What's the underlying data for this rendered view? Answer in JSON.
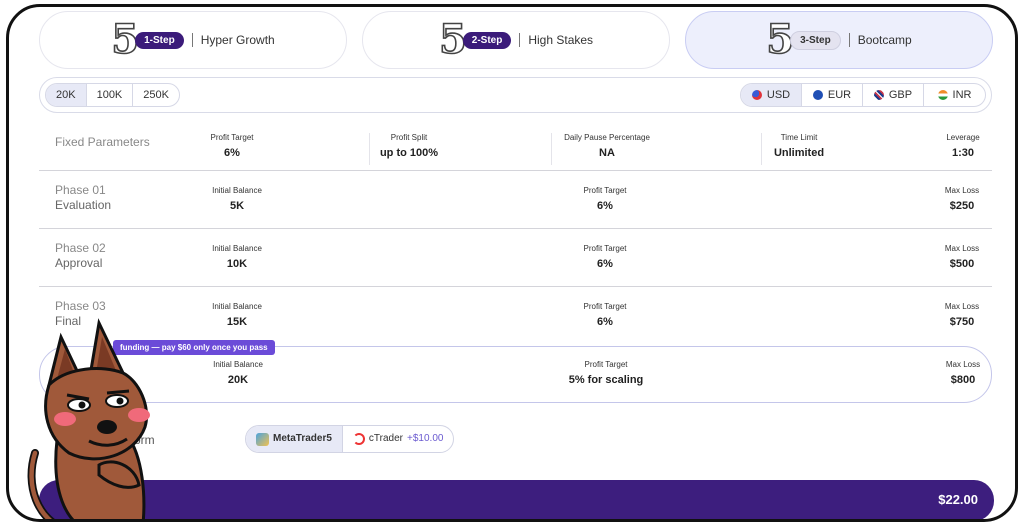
{
  "steps": [
    {
      "number": "5",
      "badge": "1-Step",
      "label": "Hyper Growth",
      "active": false
    },
    {
      "number": "5",
      "badge": "2-Step",
      "label": "High Stakes",
      "active": false
    },
    {
      "number": "5",
      "badge": "3-Step",
      "label": "Bootcamp",
      "active": true
    }
  ],
  "sizes": [
    "20K",
    "100K",
    "250K"
  ],
  "selected_size": "20K",
  "currencies": [
    {
      "code": "USD",
      "color": "#3b5bd6"
    },
    {
      "code": "EUR",
      "color": "#1f4fb5"
    },
    {
      "code": "GBP",
      "color": "#c8364a"
    },
    {
      "code": "INR",
      "color": "#f08c2a"
    }
  ],
  "selected_currency": "USD",
  "fixed": {
    "title": "Fixed Parameters",
    "cols": [
      {
        "label": "Profit Target",
        "value": "6%"
      },
      {
        "label": "Profit Split",
        "value": "up to 100%"
      },
      {
        "label": "Daily Pause Percentage",
        "value": "NA"
      },
      {
        "label": "Time Limit",
        "value": "Unlimited"
      },
      {
        "label": "Leverage",
        "value": "1:30"
      }
    ]
  },
  "phases": [
    {
      "title": "Phase 01",
      "subtitle": "Evaluation",
      "balance_label": "Initial Balance",
      "balance": "5K",
      "target_label": "Profit Target",
      "target": "6%",
      "loss_label": "Max Loss",
      "loss": "$250"
    },
    {
      "title": "Phase 02",
      "subtitle": "Approval",
      "balance_label": "Initial Balance",
      "balance": "10K",
      "target_label": "Profit Target",
      "target": "6%",
      "loss_label": "Max Loss",
      "loss": "$500"
    },
    {
      "title": "Phase 03",
      "subtitle": "Final",
      "balance_label": "Initial Balance",
      "balance": "15K",
      "target_label": "Profit Target",
      "target": "6%",
      "loss_label": "Max Loss",
      "loss": "$750"
    }
  ],
  "scaling": {
    "balance_label": "Initial Balance",
    "balance": "20K",
    "target_label": "Profit Target",
    "target": "5% for scaling",
    "loss_label": "Max Loss",
    "loss": "$800"
  },
  "promo": "funding — pay $60 only once you pass",
  "platform": {
    "label": "orm",
    "options": [
      {
        "name": "MetaTrader5",
        "extra": ""
      },
      {
        "name": "cTrader",
        "extra": "+$10.00"
      }
    ]
  },
  "total": "$22.00"
}
